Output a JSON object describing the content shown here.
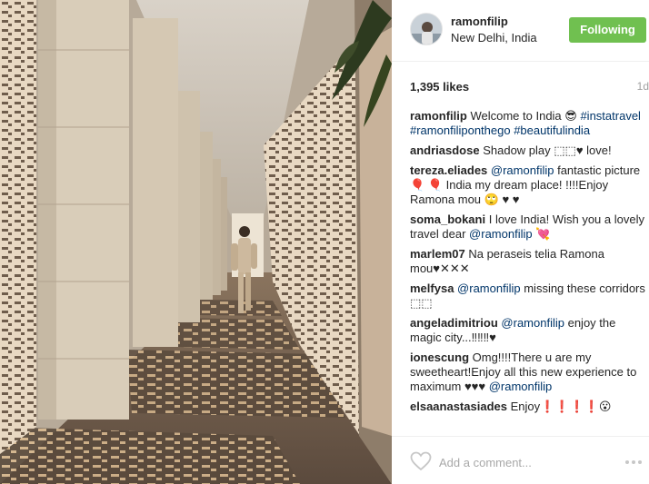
{
  "post": {
    "image_alt": "Man walking down a long corridor with lattice shadows"
  },
  "header": {
    "username": "ramonfilip",
    "location": "New Delhi, India",
    "follow_label": "Following"
  },
  "stats": {
    "likes": "1,395 likes",
    "age": "1d"
  },
  "comments": [
    {
      "user": "ramonfilip",
      "parts": [
        {
          "type": "text",
          "value": "Welcome to India 😎 "
        },
        {
          "type": "tag",
          "value": "#instatravel"
        },
        {
          "type": "text",
          "value": " "
        },
        {
          "type": "tag",
          "value": "#ramonfiliponthego"
        },
        {
          "type": "text",
          "value": " "
        },
        {
          "type": "tag",
          "value": "#beautifulindia"
        }
      ]
    },
    {
      "user": "andriasdose",
      "parts": [
        {
          "type": "text",
          "value": "Shadow play ⬚⬚♥ love!"
        }
      ]
    },
    {
      "user": "tereza.eliades",
      "parts": [
        {
          "type": "tag",
          "value": "@ramonfilip"
        },
        {
          "type": "text",
          "value": " fantastic picture 🎈 🎈 India my dream place! !!!!Enjoy Ramona mou 🙄 ♥ ♥"
        }
      ]
    },
    {
      "user": "soma_bokani",
      "parts": [
        {
          "type": "text",
          "value": "I love India! Wish you a lovely travel dear "
        },
        {
          "type": "tag",
          "value": "@ramonfilip"
        },
        {
          "type": "text",
          "value": " 💘"
        }
      ]
    },
    {
      "user": "marlem07",
      "parts": [
        {
          "type": "text",
          "value": "Na peraseis telia Ramona mou♥✕✕✕"
        }
      ]
    },
    {
      "user": "melfysa",
      "parts": [
        {
          "type": "tag",
          "value": "@ramonfilip"
        },
        {
          "type": "text",
          "value": " missing these corridors ⬚⬚"
        }
      ]
    },
    {
      "user": "angeladimitriou",
      "parts": [
        {
          "type": "tag",
          "value": "@ramonfilip"
        },
        {
          "type": "text",
          "value": " enjoy the magic city...‼‼‼♥"
        }
      ]
    },
    {
      "user": "ionescung",
      "parts": [
        {
          "type": "text",
          "value": "Omg!!!!There u are my sweetheart!Enjoy all this new experience to maximum ♥♥♥ "
        },
        {
          "type": "tag",
          "value": "@ramonfilip"
        }
      ]
    },
    {
      "user": "elsaanastasiades",
      "parts": [
        {
          "type": "text",
          "value": "Enjoy❗❗❗❗😮"
        }
      ]
    }
  ],
  "add_comment": {
    "placeholder": "Add a comment..."
  },
  "icons": {
    "heart": "heart-outline-icon",
    "more": "more-options-icon"
  },
  "colors": {
    "follow_bg": "#70c050",
    "link": "#003569",
    "muted": "#a0a0a0"
  }
}
